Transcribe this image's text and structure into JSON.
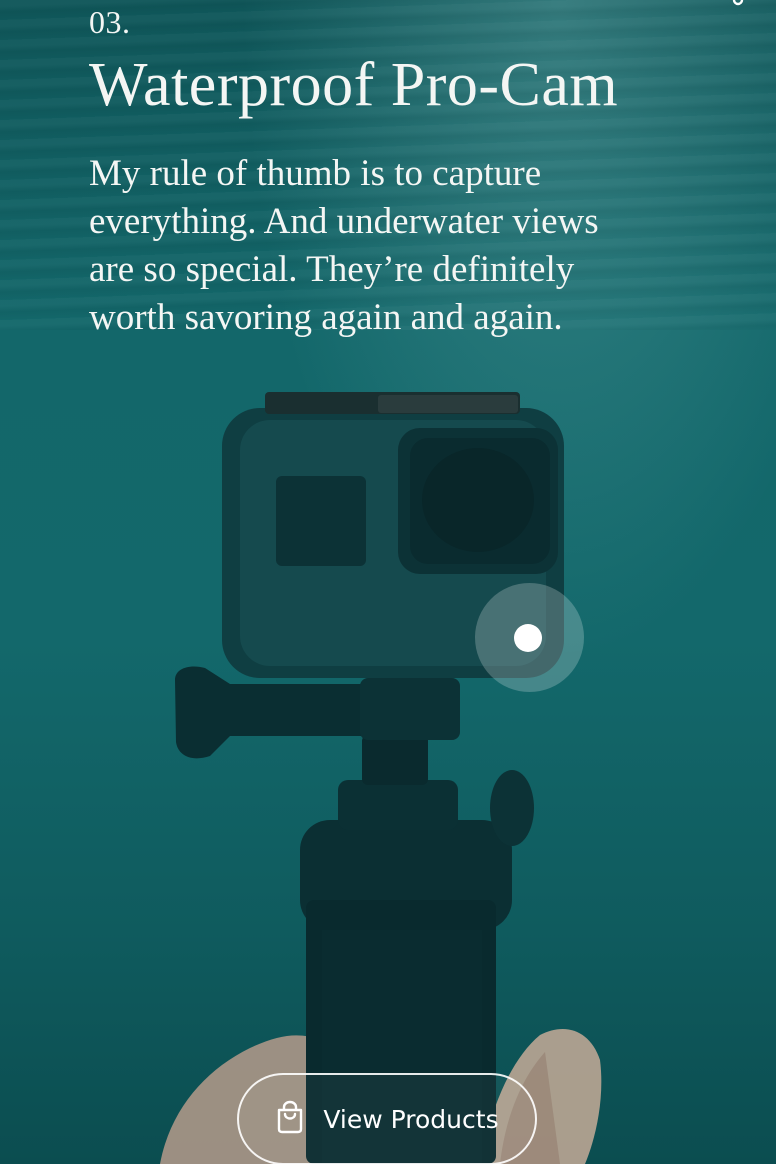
{
  "slide": {
    "number": "03.",
    "title": "Waterproof Pro-Cam",
    "description": "My rule of thumb is to capture everything. And underwater views are so special. They’re definitely worth savoring again and again."
  },
  "cta": {
    "label": "View Products",
    "icon": "shopping-bag-icon"
  },
  "hotspot": {
    "icon": "hotspot-dot"
  },
  "colors": {
    "water": "#13676a",
    "text": "#f4f6f4",
    "accent": "#ffffff"
  }
}
